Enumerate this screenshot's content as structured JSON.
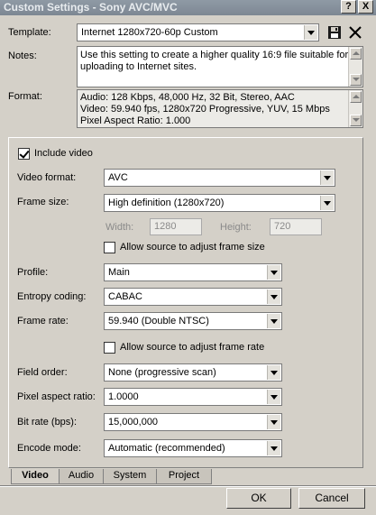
{
  "window": {
    "title": "Custom Settings - Sony AVC/MVC",
    "help_label": "?",
    "close_label": "X"
  },
  "template": {
    "label": "Template:",
    "value": "Internet 1280x720-60p Custom"
  },
  "notes": {
    "label": "Notes:",
    "lines": [
      "Use this setting to create a higher quality 16:9 file suitable for",
      "uploading to Internet sites."
    ]
  },
  "format": {
    "label": "Format:",
    "lines": [
      "Audio: 128 Kbps, 48,000 Hz, 32 Bit, Stereo, AAC",
      "Video: 59.940 fps, 1280x720 Progressive, YUV, 15 Mbps",
      "Pixel Aspect Ratio: 1.000"
    ]
  },
  "video": {
    "include_label": "Include video",
    "include_checked": true,
    "video_format": {
      "label": "Video format:",
      "value": "AVC"
    },
    "frame_size": {
      "label": "Frame size:",
      "value": "High definition (1280x720)"
    },
    "width": {
      "label": "Width:",
      "value": "1280"
    },
    "height": {
      "label": "Height:",
      "value": "720"
    },
    "allow_frame_size": {
      "label": "Allow source to adjust frame size",
      "checked": false
    },
    "profile": {
      "label": "Profile:",
      "value": "Main"
    },
    "entropy": {
      "label": "Entropy coding:",
      "value": "CABAC"
    },
    "frame_rate": {
      "label": "Frame rate:",
      "value": "59.940 (Double NTSC)"
    },
    "allow_frame_rate": {
      "label": "Allow source to adjust frame rate",
      "checked": false
    },
    "field_order": {
      "label": "Field order:",
      "value": "None (progressive scan)"
    },
    "pixel_aspect": {
      "label": "Pixel aspect ratio:",
      "value": "1.0000"
    },
    "bit_rate": {
      "label": "Bit rate (bps):",
      "value": "15,000,000"
    },
    "encode_mode": {
      "label": "Encode mode:",
      "value": "Automatic (recommended)"
    }
  },
  "tabs": [
    {
      "label": "Video",
      "active": true
    },
    {
      "label": "Audio",
      "active": false
    },
    {
      "label": "System",
      "active": false
    },
    {
      "label": "Project",
      "active": false
    }
  ],
  "buttons": {
    "ok": "OK",
    "cancel": "Cancel"
  }
}
